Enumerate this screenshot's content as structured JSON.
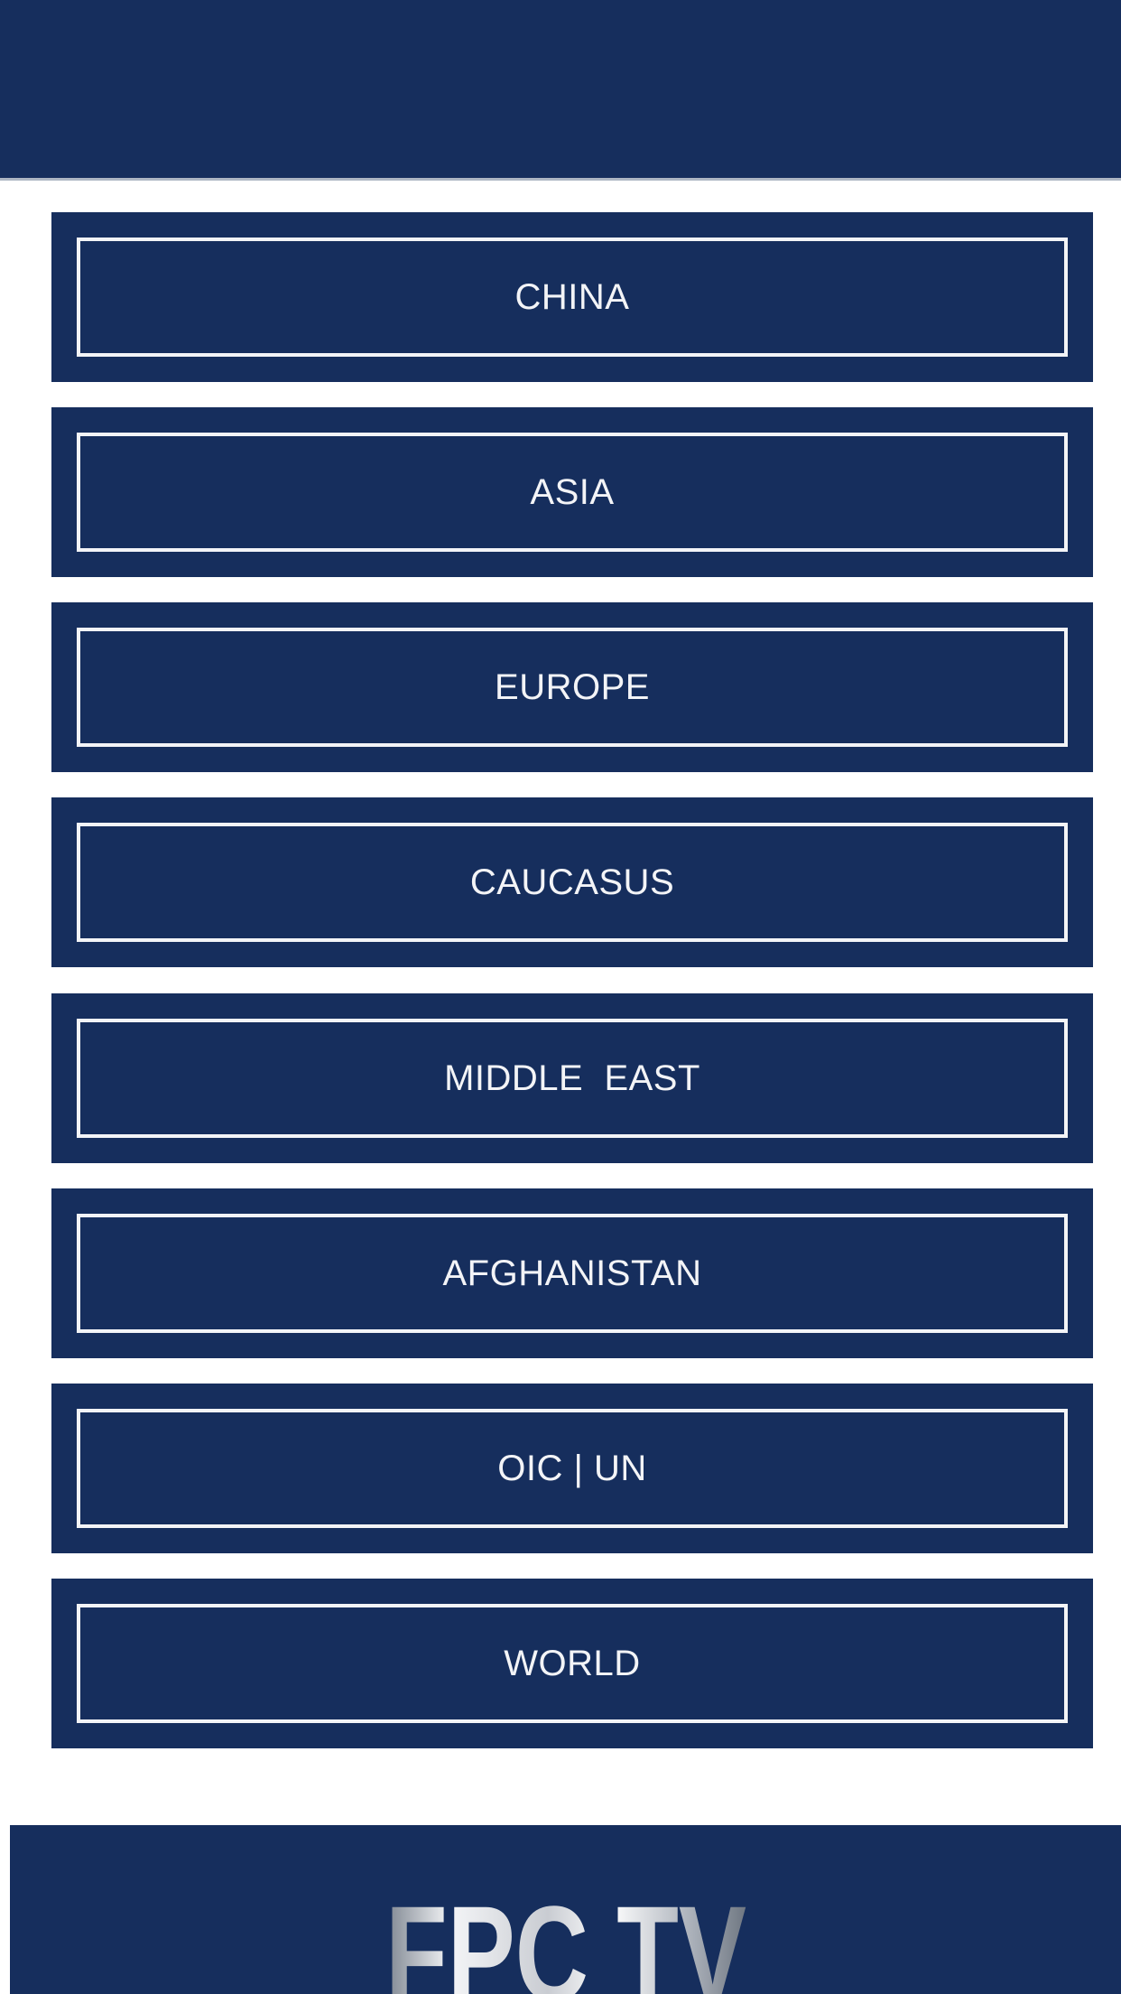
{
  "menu": {
    "items": [
      {
        "label": "CHINA"
      },
      {
        "label": "ASIA"
      },
      {
        "label": "EUROPE"
      },
      {
        "label": "CAUCASUS"
      },
      {
        "label": "MIDDLE  EAST"
      },
      {
        "label": "AFGHANISTAN"
      },
      {
        "label": "OIC | UN"
      },
      {
        "label": "WORLD"
      }
    ]
  },
  "footer": {
    "logo_text": "FPC TV"
  },
  "colors": {
    "navy": "#162e5d",
    "tile_text": "#f3f4f7",
    "page_bg": "#ffffff"
  }
}
